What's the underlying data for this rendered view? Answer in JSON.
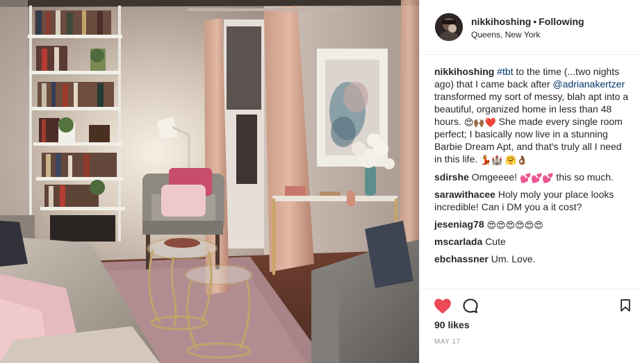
{
  "header": {
    "username": "nikkihoshing",
    "separator": "•",
    "follow_status": "Following",
    "location": "Queens, New York"
  },
  "caption": {
    "username": "nikkihoshing",
    "hashtag": "#tbt",
    "text_1": " to the time (...two nights ago) that I came back after ",
    "mention": "@adrianakertzer",
    "text_2": " transformed my sort of messy, blah apt into a beautiful, organized home in less than 48 hours. ",
    "emoji_1": "😍🙌🏾❤️",
    "text_3": " She made every single room perfect; I basically now live in a stunning Barbie Dream Apt, and that's truly all I need in this life. ",
    "emoji_2": "💃🏰 🤗👌🏾"
  },
  "comments": [
    {
      "username": "sdirshe",
      "text": "Omgeeee! ",
      "emoji": "💕💕💕",
      "text_after": " this so much."
    },
    {
      "username": "sarawithacee",
      "text": "Holy moly your place looks incredible! Can i DM you a it cost?",
      "emoji": "",
      "text_after": ""
    },
    {
      "username": "jeseniag78",
      "text": "",
      "emoji": "😍😍😍😍😍😍",
      "text_after": ""
    },
    {
      "username": "mscarlada",
      "text": "Cute",
      "emoji": "",
      "text_after": ""
    },
    {
      "username": "ebchassner",
      "text": "Um. Love.",
      "emoji": "",
      "text_after": ""
    }
  ],
  "actions": {
    "like_icon": "heart-icon",
    "comment_icon": "speech-bubble-icon",
    "save_icon": "bookmark-icon",
    "like_color": "#ed4956"
  },
  "likes": "90 likes",
  "date": "MAY 17"
}
